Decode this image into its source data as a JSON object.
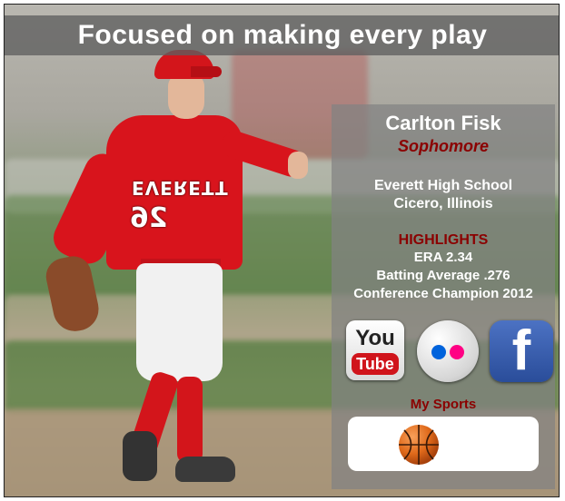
{
  "banner": {
    "headline": "Focused on making every play"
  },
  "photo": {
    "jersey_text": "EVERETT",
    "jersey_number": "26"
  },
  "profile": {
    "name": "Carlton Fisk",
    "class_year": "Sophomore",
    "school": "Everett High School",
    "location": "Cicero, Illinois",
    "highlights_heading": "HIGHLIGHTS",
    "highlights": [
      "ERA 2.34",
      "Batting Average .276",
      "Conference Champion 2012"
    ]
  },
  "social": {
    "youtube": {
      "icon": "youtube-icon",
      "word_top": "You",
      "word_bottom": "Tube"
    },
    "flickr": {
      "icon": "flickr-icon"
    },
    "facebook": {
      "icon": "facebook-icon",
      "glyph": "f"
    }
  },
  "sports": {
    "label": "My Sports",
    "items": [
      {
        "icon": "basketball-icon"
      }
    ]
  },
  "colors": {
    "accent_dark_red": "#8b0000",
    "panel_gray": "#828282",
    "youtube_red": "#d0141b",
    "flickr_blue": "#0063dc",
    "flickr_pink": "#ff0084",
    "facebook_blue": "#3b5998",
    "basketball_orange": "#e06a1b"
  }
}
